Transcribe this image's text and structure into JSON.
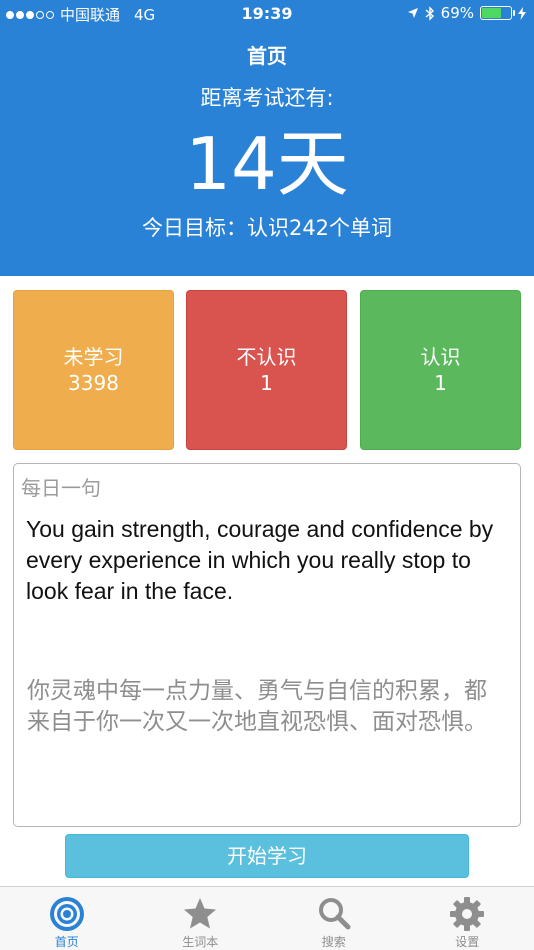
{
  "status_bar": {
    "carrier": "中国联通",
    "network": "4G",
    "time": "19:39",
    "battery": "69%",
    "battery_level": 0.69
  },
  "header": {
    "title": "首页",
    "countdown_label": "距离考试还有:",
    "countdown_value": "14天",
    "goal": "今日目标：认识242个单词"
  },
  "stats": {
    "unlearned": {
      "label": "未学习",
      "count": "3398"
    },
    "unknown": {
      "label": "不认识",
      "count": "1"
    },
    "known": {
      "label": "认识",
      "count": "1"
    }
  },
  "daily": {
    "title": "每日一句",
    "english": "You gain strength, courage and confidence by every experience in which you really stop to look fear in the face.",
    "chinese": "你灵魂中每一点力量、勇气与自信的积累，都来自于你一次又一次地直视恐惧、面对恐惧。"
  },
  "start_button": "开始学习",
  "tabs": [
    {
      "label": "首页",
      "icon": "target-icon",
      "active": true
    },
    {
      "label": "生词本",
      "icon": "star-icon",
      "active": false
    },
    {
      "label": "搜索",
      "icon": "search-icon",
      "active": false
    },
    {
      "label": "设置",
      "icon": "gear-icon",
      "active": false
    }
  ],
  "colors": {
    "primary": "#2a82d6",
    "unlearned": "#f0ad4e",
    "unknown": "#d9534f",
    "known": "#5cb85c",
    "button": "#5bc0de"
  }
}
